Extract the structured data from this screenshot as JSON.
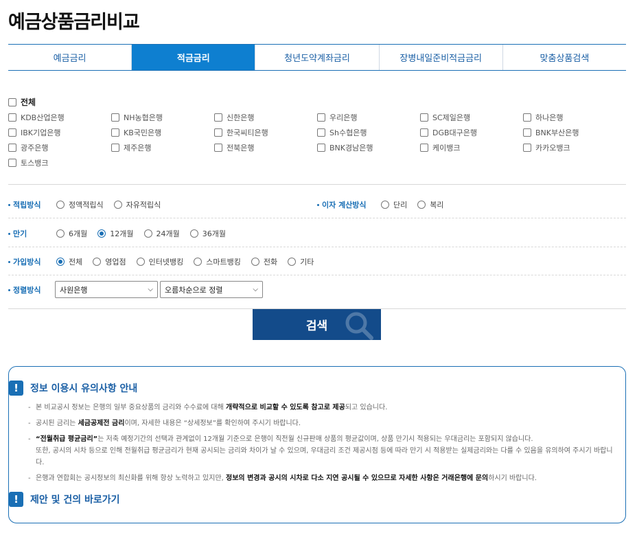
{
  "page_title": "예금상품금리비교",
  "tabs": [
    {
      "label": "예금금리",
      "active": false
    },
    {
      "label": "적금금리",
      "active": true
    },
    {
      "label": "청년도약계좌금리",
      "active": false
    },
    {
      "label": "장병내일준비적금금리",
      "active": false
    },
    {
      "label": "맞춤상품검색",
      "active": false
    }
  ],
  "banks": {
    "all_label": "전체",
    "items": [
      "KDB산업은행",
      "NH농협은행",
      "신한은행",
      "우리은행",
      "SC제일은행",
      "하나은행",
      "IBK기업은행",
      "KB국민은행",
      "한국씨티은행",
      "Sh수협은행",
      "DGB대구은행",
      "BNK부산은행",
      "광주은행",
      "제주은행",
      "전북은행",
      "BNK경남은행",
      "케이뱅크",
      "카카오뱅크",
      "토스뱅크"
    ]
  },
  "filters": {
    "saving_method": {
      "label": "적립방식",
      "options": [
        "정액적립식",
        "자유적립식"
      ],
      "selected": null
    },
    "interest_method": {
      "label": "이자 계산방식",
      "options": [
        "단리",
        "복리"
      ],
      "selected": null
    },
    "term": {
      "label": "만기",
      "options": [
        "6개월",
        "12개월",
        "24개월",
        "36개월"
      ],
      "selected": "12개월"
    },
    "join_method": {
      "label": "가입방식",
      "options": [
        "전체",
        "영업점",
        "인터넷뱅킹",
        "스마트뱅킹",
        "전화",
        "기타"
      ],
      "selected": "전체"
    },
    "sort": {
      "label": "정렬방식",
      "primary": "사원은행",
      "order": "오름차순으로 정렬"
    }
  },
  "search_label": "검색",
  "notice": {
    "title": "정보 이용시 유의사항 안내",
    "items": [
      {
        "pre": "본 비교공시 정보는 은행의 일부 중요상품의 금리와 수수료에 대해 ",
        "bold": "개략적으로 비교할 수 있도록 참고로 제공",
        "post": "되고 있습니다."
      },
      {
        "pre": "공시된 금리는 ",
        "bold": "세금공제전 금리",
        "post": "이며, 자세한 내용은 “상세정보”를 확인하여 주시기 바랍니다."
      },
      {
        "pre": "",
        "bold": "“전월취급 평균금리”",
        "post": "는 저축 예정기간의 선택과 관계없이 12개월 기준으로 은행이 직전월 신규판매 상품의 평균값이며, 상품 만기시 적용되는 우대금리는 포함되지 않습니다.",
        "extra": "또한, 공시의 시차 등으로 인해 전월취급 평균금리가 현재 공시되는 금리와 차이가 날 수 있으며, 우대금리 조건 제공시점 등에 따라 만기 시 적용받는 실제금리와는 다를 수 있음을 유의하여 주시기 바랍니다."
      },
      {
        "pre": "은행과 연합회는 공시정보의 최신화를 위해 항상 노력하고 있지만, ",
        "bold": "정보의 변경과 공시의 시차로 다소 지연 공시될 수 있으므로 자세한 사항은 거래은행에 문의",
        "post": "하시기 바랍니다."
      }
    ],
    "link_title": "제안 및 건의 바로가기"
  }
}
